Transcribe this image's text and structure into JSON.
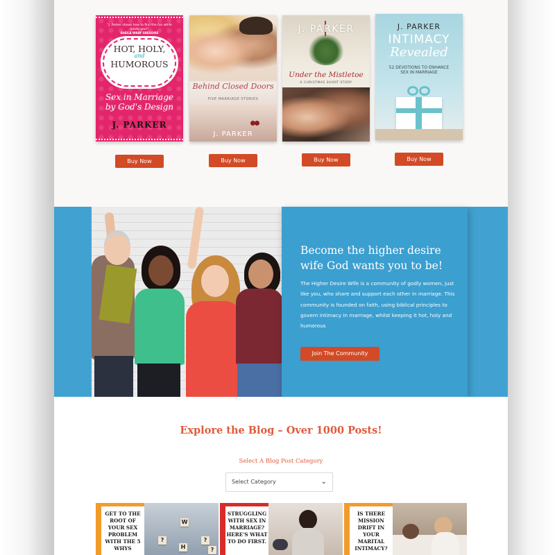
{
  "books": [
    {
      "quote": "\"J. Parker shows how to find the fun while inside you!\"",
      "quote_source": "SHEILA WRAY GREGOIRE",
      "title_top": "HOT, HOLY,",
      "title_and": "and",
      "title_bottom": "HUMOROUS",
      "subtitle": "Sex in Marriage by God's Design",
      "author": "J. PARKER",
      "buy_label": "Buy Now"
    },
    {
      "title": "Behind Closed Doors",
      "subtitle": "FIVE MARRIAGE STORIES",
      "author": "J. PARKER",
      "buy_label": "Buy Now"
    },
    {
      "author": "J. PARKER",
      "title": "Under the Mistletoe",
      "subtitle": "A CHRISTMAS SHORT STORY",
      "buy_label": "Buy Now"
    },
    {
      "author": "J. PARKER",
      "title_top": "INTIMACY",
      "title_bottom": "Revealed",
      "subtitle": "52 DEVOTIONS TO ENHANCE SEX IN MARRIAGE",
      "buy_label": "Buy Now"
    }
  ],
  "community": {
    "heading": "Become the higher desire wife God wants you to be!",
    "body": "The Higher Desire Wife is a community of godly women, just like you, who share and support each other in marriage. This community is founded on faith, using biblical principles to govern intimacy in marriage, whilst keeping it hot, holy and humorous",
    "button_label": "Join The Community",
    "band_color": "#41a2d1"
  },
  "blog": {
    "title": "Explore the Blog – Over 1000 Posts!",
    "category_label": "Select A Blog Post Category",
    "select_value": "Select Category",
    "posts": [
      {
        "title": "GET TO THE ROOT OF YOUR SEX PROBLEM WITH THE 5 WHYS"
      },
      {
        "title": "STRUGGLING WITH SEX IN MARRIAGE? HERE'S WHAT TO DO FIRST."
      },
      {
        "title": "IS THERE MISSION DRIFT IN YOUR MARITAL INTIMACY?"
      }
    ]
  },
  "accent_color": "#d24a26"
}
